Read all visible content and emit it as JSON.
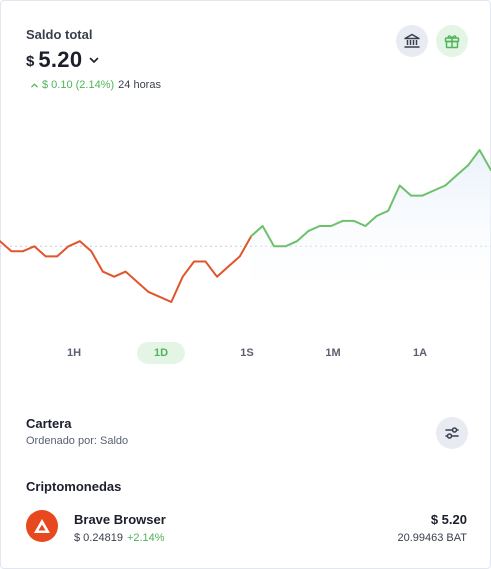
{
  "balance": {
    "label": "Saldo total",
    "currency_symbol": "$",
    "amount": "5.20",
    "change_text": "$ 0.10 (2.14%)",
    "period_text": "24 horas",
    "change_color": "#4fb45a"
  },
  "actions": {
    "bank_icon": "bank-icon",
    "gift_icon": "gift-icon"
  },
  "chart_data": {
    "type": "line",
    "x": [
      0,
      1,
      2,
      3,
      4,
      5,
      6,
      7,
      8,
      9,
      10,
      11,
      12,
      13,
      14,
      15,
      16,
      17,
      18,
      19,
      20,
      21,
      22,
      23,
      24,
      25,
      26,
      27,
      28,
      29,
      30,
      31,
      32,
      33,
      34,
      35,
      36,
      37,
      38,
      39,
      40,
      41,
      42,
      43,
      44,
      45,
      46,
      47,
      48,
      49,
      50,
      51,
      52,
      53,
      54,
      55,
      56,
      57,
      58,
      59
    ],
    "values": [
      5.11,
      5.09,
      5.09,
      5.1,
      5.08,
      5.08,
      5.1,
      5.11,
      5.09,
      5.05,
      5.04,
      5.05,
      5.03,
      5.01,
      5.0,
      4.99,
      5.04,
      5.07,
      5.07,
      5.04,
      5.06,
      5.08,
      5.12,
      5.14,
      5.1,
      5.1,
      5.11,
      5.13,
      5.14,
      5.14,
      5.15,
      5.15,
      5.14,
      5.16,
      5.17,
      5.22,
      5.2,
      5.2,
      5.21,
      5.22,
      5.24,
      5.26,
      5.29,
      5.25
    ],
    "baseline": 5.1,
    "up_color": "#6cc16a",
    "down_color": "#e0552b"
  },
  "time_tabs": [
    {
      "label": "1H",
      "active": false
    },
    {
      "label": "1D",
      "active": true
    },
    {
      "label": "1S",
      "active": false
    },
    {
      "label": "1M",
      "active": false
    },
    {
      "label": "1A",
      "active": false
    }
  ],
  "portfolio": {
    "title": "Cartera",
    "sort_text": "Ordenado por: Saldo",
    "filter_icon": "sliders-icon"
  },
  "crypto": {
    "title": "Criptomonedas",
    "assets": [
      {
        "name": "Brave Browser",
        "price": "$ 0.24819",
        "change": "+2.14%",
        "fiat_balance": "$ 5.20",
        "token_balance": "20.99463 BAT",
        "icon": "bat-logo-icon",
        "icon_color": "#e8481e"
      }
    ]
  }
}
